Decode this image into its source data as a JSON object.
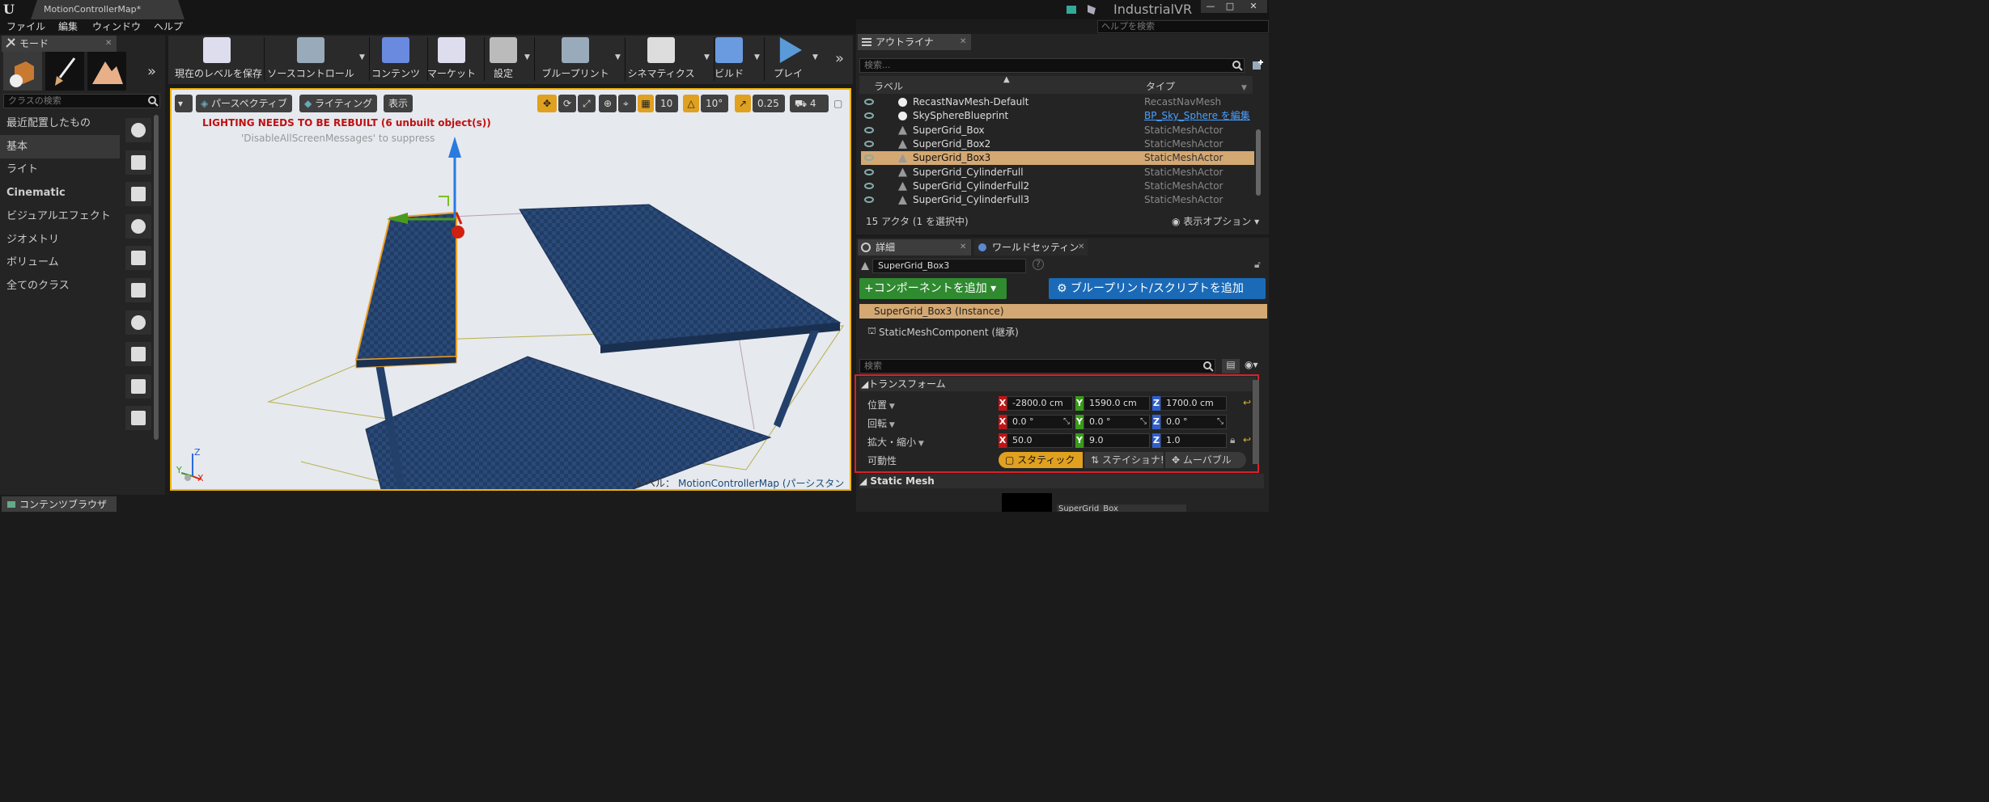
{
  "window": {
    "tab_title": "MotionControllerMap*",
    "project": "IndustrialVR",
    "help_search_placeholder": "ヘルプを検索",
    "controls": [
      "—",
      "□",
      "✕"
    ]
  },
  "menu": [
    "ファイル",
    "編集",
    "ウィンドウ",
    "ヘルプ"
  ],
  "modes": {
    "title": "モード",
    "search_placeholder": "クラスの検索",
    "categories": [
      "最近配置したもの",
      "基本",
      "ライト",
      "Cinematic",
      "ビジュアルエフェクト",
      "ジオメトリ",
      "ボリューム",
      "全てのクラス"
    ],
    "selected": "基本"
  },
  "toolbar": [
    {
      "label": "現在のレベルを保存",
      "icon": "save-icon"
    },
    {
      "label": "ソースコントロール",
      "icon": "source-control-icon"
    },
    {
      "label": "コンテンツ",
      "icon": "content-icon"
    },
    {
      "label": "マーケット",
      "icon": "marketplace-icon"
    },
    {
      "label": "設定",
      "icon": "settings-icon"
    },
    {
      "label": "ブループリント",
      "icon": "blueprint-icon"
    },
    {
      "label": "シネマティクス",
      "icon": "cinematics-icon"
    },
    {
      "label": "ビルド",
      "icon": "build-icon"
    },
    {
      "label": "プレイ",
      "icon": "play-icon"
    }
  ],
  "viewport": {
    "perspective": "パースペクティブ",
    "lighting": "ライティング",
    "show": "表示",
    "grid_snap": "10",
    "rot_snap": "10°",
    "scale_snap": "0.25",
    "cam_speed": "4",
    "warning": "LIGHTING NEEDS TO BE REBUILT (6 unbuilt object(s))",
    "suppress": "'DisableAllScreenMessages' to suppress",
    "level_label": "レベル：",
    "level_name": "MotionControllerMap (パーシスタント)",
    "axis_z": "Z",
    "axis_y": "Y",
    "axis_x": "X",
    "colors": {
      "warning": "#c01010",
      "selection": "#f0a020"
    }
  },
  "outliner": {
    "title": "アウトライナ",
    "search_placeholder": "検索...",
    "col_label": "ラベル",
    "col_type": "タイプ",
    "rows": [
      {
        "name": "RecastNavMesh-Default",
        "type": "RecastNavMesh"
      },
      {
        "name": "SkySphereBlueprint",
        "type": "BP_Sky_Sphere を編集"
      },
      {
        "name": "SuperGrid_Box",
        "type": "StaticMeshActor"
      },
      {
        "name": "SuperGrid_Box2",
        "type": "StaticMeshActor"
      },
      {
        "name": "SuperGrid_Box3",
        "type": "StaticMeshActor"
      },
      {
        "name": "SuperGrid_CylinderFull",
        "type": "StaticMeshActor"
      },
      {
        "name": "SuperGrid_CylinderFull2",
        "type": "StaticMeshActor"
      },
      {
        "name": "SuperGrid_CylinderFull3",
        "type": "StaticMeshActor"
      }
    ],
    "count": "15 アクタ (1 を選択中)",
    "view_options": "表示オプション"
  },
  "details": {
    "tab": "詳細",
    "tab2": "ワールドセッティン",
    "actor_name": "SuperGrid_Box3",
    "add_component": "コンポーネントを追加",
    "add_blueprint": "ブループリント/スクリプトを追加",
    "instance": "SuperGrid_Box3 (Instance)",
    "component": "StaticMeshComponent (継承)",
    "search_placeholder": "検索",
    "transform": {
      "title": "トランスフォーム",
      "location_label": "位置",
      "rotation_label": "回転",
      "scale_label": "拡大・縮小",
      "mobility_label": "可動性",
      "location": [
        "-2800.0 cm",
        "1590.0 cm",
        "1700.0 cm"
      ],
      "rotation": [
        "0.0 °",
        "0.0 °",
        "0.0 °"
      ],
      "scale": [
        "50.0",
        "9.0",
        "1.0"
      ],
      "mobility": [
        "スタティック",
        "ステイショナ!",
        "ムーバブル"
      ],
      "axes": [
        "X",
        "Y",
        "Z"
      ]
    },
    "static_mesh_title": "Static Mesh",
    "mesh_value": "SuperGrid_Box"
  },
  "content_browser": "コンテンツブラウザ"
}
